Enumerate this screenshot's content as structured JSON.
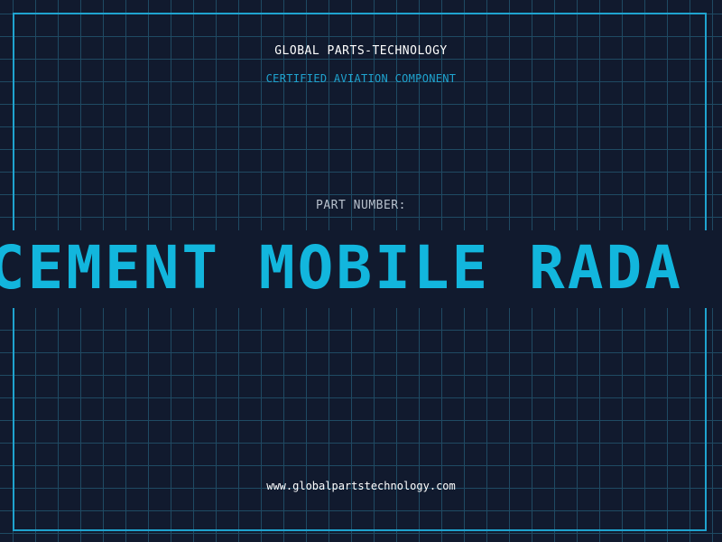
{
  "header": {
    "brand": "GLOBAL PARTS-TECHNOLOGY",
    "subtitle": "CERTIFIED AVIATION COMPONENT"
  },
  "part": {
    "label": "PART NUMBER:",
    "value": "RCEMENT MOBILE RADA"
  },
  "footer": {
    "url": "www.globalpartstechnology.com"
  },
  "colors": {
    "background": "#111a2e",
    "grid": "#1f4a63",
    "accent": "#1fa3cf",
    "part_text": "#12b6dd"
  }
}
